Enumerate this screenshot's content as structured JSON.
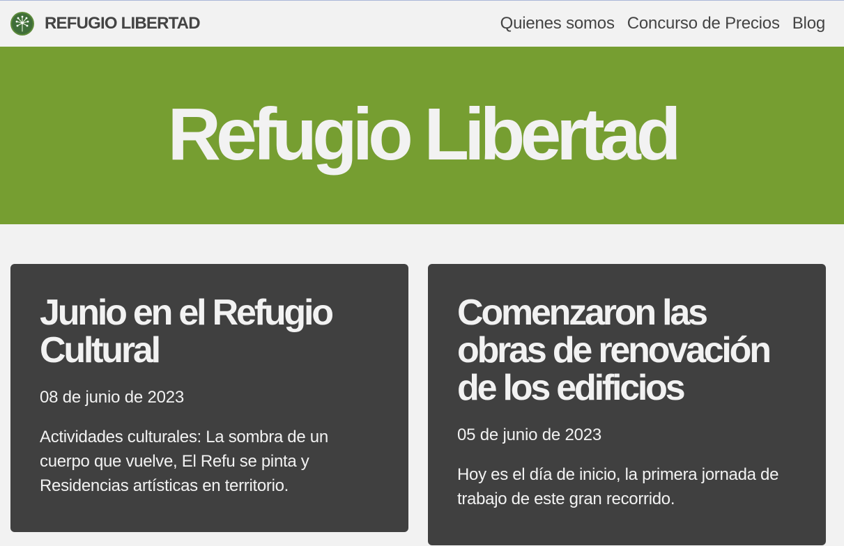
{
  "colors": {
    "hero_background": "#769e31",
    "page_background": "#f2f2f2",
    "card_background": "#404040",
    "nav_text": "#444444",
    "light_text": "#f2f2f2"
  },
  "navbar": {
    "logo_icon": "dandelion-logo-icon",
    "brand": "REFUGIO LIBERTAD",
    "links": [
      "Quienes somos",
      "Concurso de Precios",
      "Blog"
    ]
  },
  "hero": {
    "title": "Refugio Libertad"
  },
  "posts": [
    {
      "title": "Junio en el Refugio Cultural",
      "date": "08 de junio de 2023",
      "excerpt": "Actividades culturales: La sombra de un cuerpo que vuelve, El Refu se pinta y Residencias artísticas en territorio."
    },
    {
      "title": "Comenzaron las obras de renovación de los edificios",
      "date": "05 de junio de 2023",
      "excerpt": "Hoy es el día de inicio, la primera jornada de trabajo de este gran recorrido."
    }
  ]
}
